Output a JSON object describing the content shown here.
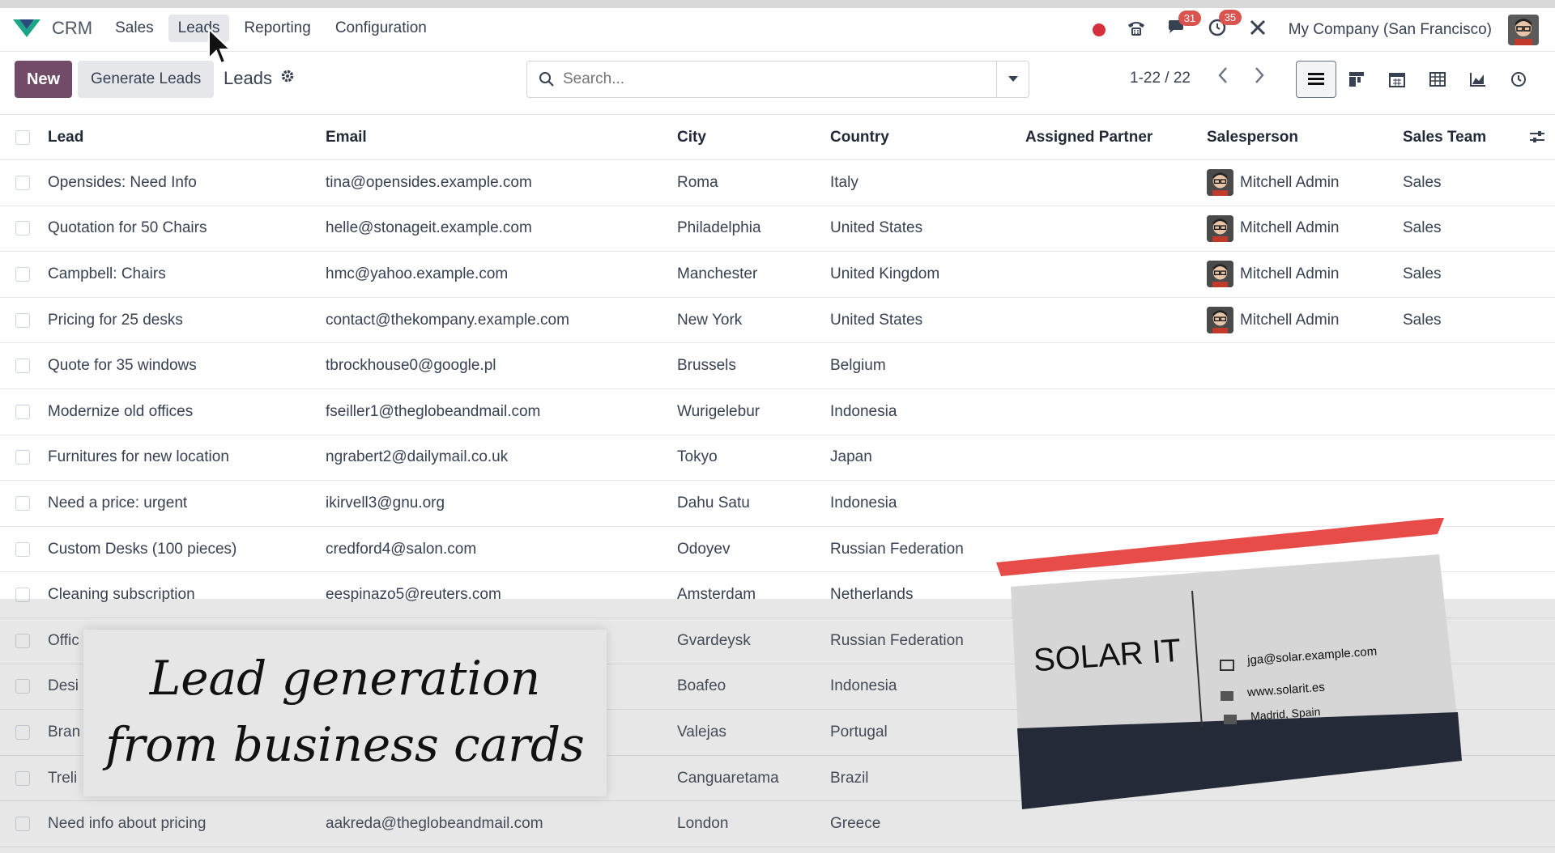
{
  "app": {
    "name": "CRM"
  },
  "menu": [
    "Sales",
    "Leads",
    "Reporting",
    "Configuration"
  ],
  "systray": {
    "messages_count": "31",
    "activities_count": "35",
    "company": "My Company (San Francisco)"
  },
  "control": {
    "new_label": "New",
    "generate_label": "Generate Leads",
    "title": "Leads",
    "search_placeholder": "Search...",
    "pager": "1-22 / 22"
  },
  "columns": {
    "lead": "Lead",
    "email": "Email",
    "city": "City",
    "country": "Country",
    "partner": "Assigned Partner",
    "salesperson": "Salesperson",
    "team": "Sales Team"
  },
  "rows": [
    {
      "lead": "Opensides: Need Info",
      "email": "tina@opensides.example.com",
      "city": "Roma",
      "country": "Italy",
      "salesperson": "Mitchell Admin",
      "team": "Sales"
    },
    {
      "lead": "Quotation for 50 Chairs",
      "email": "helle@stonageit.example.com",
      "city": "Philadelphia",
      "country": "United States",
      "salesperson": "Mitchell Admin",
      "team": "Sales"
    },
    {
      "lead": "Campbell: Chairs",
      "email": "hmc@yahoo.example.com",
      "city": "Manchester",
      "country": "United Kingdom",
      "salesperson": "Mitchell Admin",
      "team": "Sales"
    },
    {
      "lead": "Pricing for 25 desks",
      "email": "contact@thekompany.example.com",
      "city": "New York",
      "country": "United States",
      "salesperson": "Mitchell Admin",
      "team": "Sales"
    },
    {
      "lead": "Quote for 35 windows",
      "email": "tbrockhouse0@google.pl",
      "city": "Brussels",
      "country": "Belgium",
      "salesperson": "",
      "team": ""
    },
    {
      "lead": "Modernize old offices",
      "email": "fseiller1@theglobeandmail.com",
      "city": "Wurigelebur",
      "country": "Indonesia",
      "salesperson": "",
      "team": ""
    },
    {
      "lead": "Furnitures for new location",
      "email": "ngrabert2@dailymail.co.uk",
      "city": "Tokyo",
      "country": "Japan",
      "salesperson": "",
      "team": ""
    },
    {
      "lead": "Need a price: urgent",
      "email": "ikirvell3@gnu.org",
      "city": "Dahu Satu",
      "country": "Indonesia",
      "salesperson": "",
      "team": ""
    },
    {
      "lead": "Custom Desks (100 pieces)",
      "email": "credford4@salon.com",
      "city": "Odoyev",
      "country": "Russian Federation",
      "salesperson": "",
      "team": ""
    },
    {
      "lead": "Cleaning subscription",
      "email": "eespinazo5@reuters.com",
      "city": "Amsterdam",
      "country": "Netherlands",
      "salesperson": "",
      "team": ""
    },
    {
      "lead": "Offic",
      "email": "",
      "city": "Gvardeysk",
      "country": "Russian Federation",
      "salesperson": "",
      "team": ""
    },
    {
      "lead": "Desi",
      "email": "",
      "city": "Boafeo",
      "country": "Indonesia",
      "salesperson": "",
      "team": ""
    },
    {
      "lead": "Bran",
      "email": "",
      "city": "Valejas",
      "country": "Portugal",
      "salesperson": "",
      "team": ""
    },
    {
      "lead": "Treli",
      "email": "",
      "city": "Canguaretama",
      "country": "Brazil",
      "salesperson": "",
      "team": ""
    },
    {
      "lead": "Need info about pricing",
      "email": "aakreda@theglobeandmail.com",
      "city": "London",
      "country": "Greece",
      "salesperson": "",
      "team": ""
    }
  ],
  "caption": {
    "line1": "Lead generation",
    "line2": "from business cards"
  },
  "business_card": {
    "company": "SOLAR IT",
    "email": "jga@solar.example.com",
    "website": "www.solarit.es",
    "location": "Madrid, Spain"
  },
  "colors": {
    "primary": "#714b67",
    "badge": "#d9534f",
    "record": "#d62f3c",
    "laser": "#e53935"
  }
}
